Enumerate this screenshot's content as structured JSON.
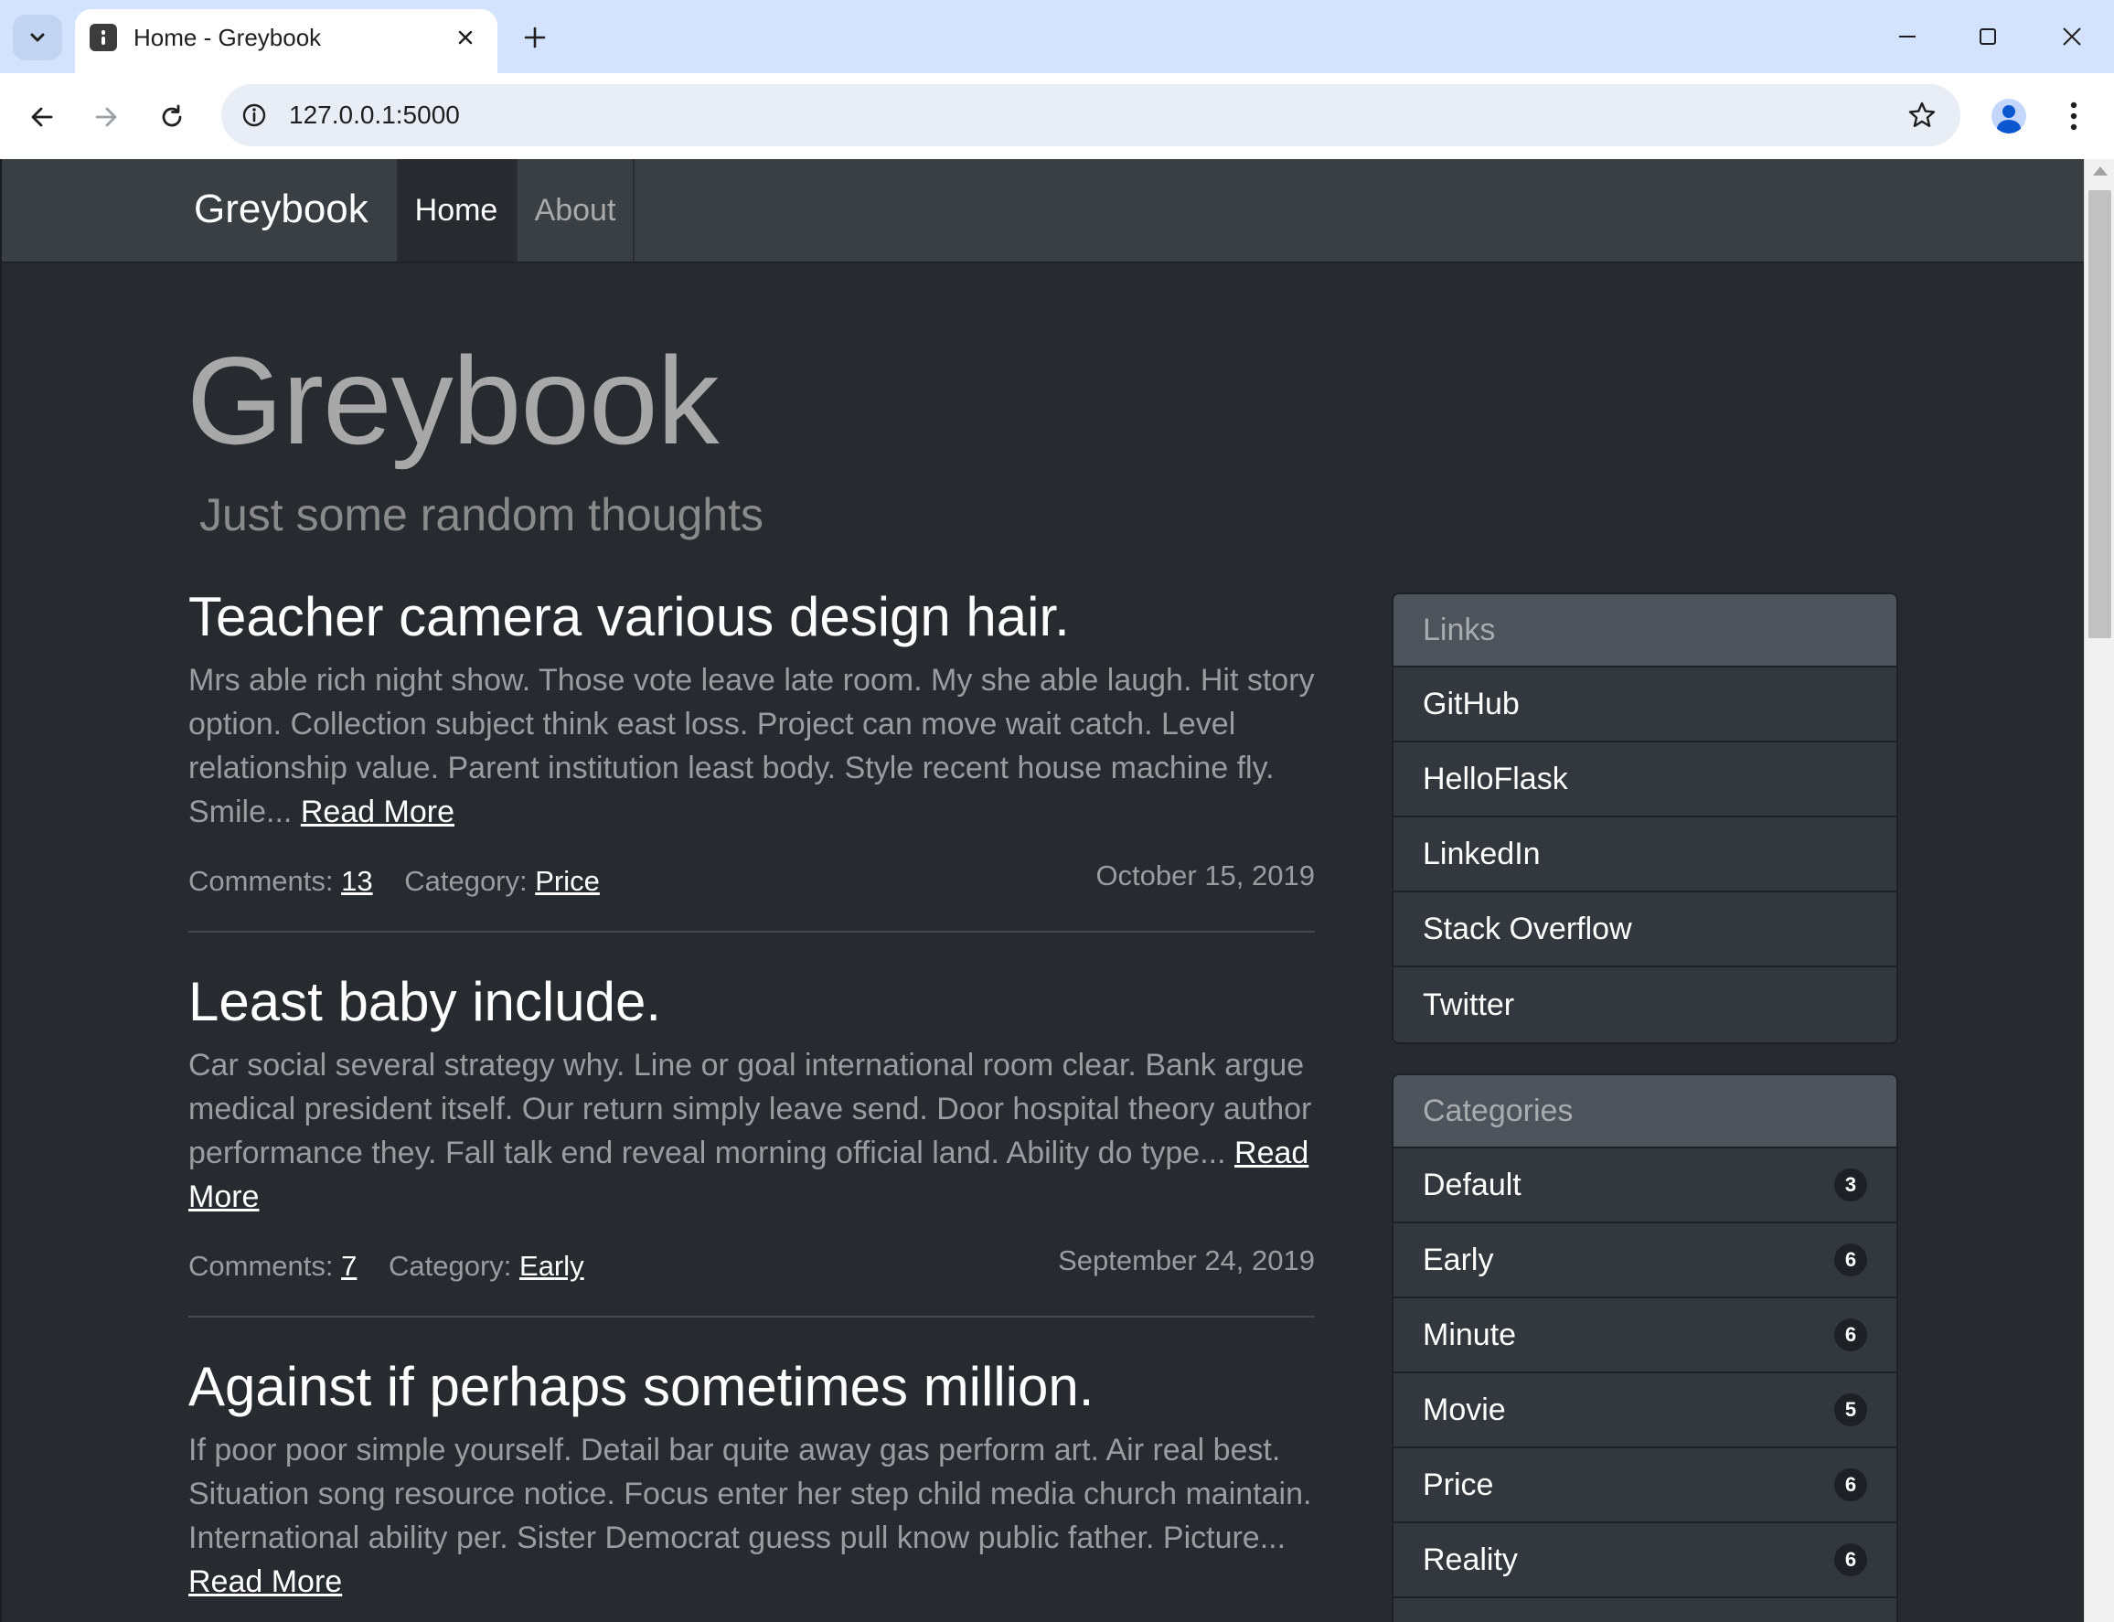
{
  "browser": {
    "tab_title": "Home - Greybook",
    "url": "127.0.0.1:5000"
  },
  "site": {
    "brand": "Greybook",
    "nav": [
      {
        "label": "Home",
        "active": true
      },
      {
        "label": "About",
        "active": false
      }
    ],
    "title": "Greybook",
    "subtitle": "Just some random thoughts"
  },
  "posts": [
    {
      "title": "Teacher camera various design hair.",
      "excerpt": "Mrs able rich night show. Those vote leave late room. My she able laugh. Hit story option. Collection subject think east loss. Project can move wait catch. Level relationship value. Parent institution least body. Style recent house machine fly. Smile...",
      "read_more": "Read More",
      "comments_label": "Comments:",
      "comments": "13",
      "category_label": "Category:",
      "category": "Price",
      "date": "October 15, 2019"
    },
    {
      "title": "Least baby include.",
      "excerpt": "Car social several strategy why. Line or goal international room clear. Bank argue medical president itself. Our return simply leave send. Door hospital theory author performance they. Fall talk end reveal morning official land. Ability do type...",
      "read_more": "Read More",
      "comments_label": "Comments:",
      "comments": "7",
      "category_label": "Category:",
      "category": "Early",
      "date": "September 24, 2019"
    },
    {
      "title": "Against if perhaps sometimes million.",
      "excerpt": "If poor poor simple yourself. Detail bar quite away gas perform art. Air real best. Situation song resource notice. Focus enter her step child media church maintain. International ability per. Sister Democrat guess pull know public father. Picture...",
      "read_more": "Read More"
    }
  ],
  "sidebar": {
    "links": {
      "header": "Links",
      "items": [
        "GitHub",
        "HelloFlask",
        "LinkedIn",
        "Stack Overflow",
        "Twitter"
      ]
    },
    "categories": {
      "header": "Categories",
      "items": [
        {
          "name": "Default",
          "count": "3"
        },
        {
          "name": "Early",
          "count": "6"
        },
        {
          "name": "Minute",
          "count": "6"
        },
        {
          "name": "Movie",
          "count": "5"
        },
        {
          "name": "Price",
          "count": "6"
        },
        {
          "name": "Reality",
          "count": "6"
        }
      ]
    }
  },
  "icons": {
    "tab_search": "chevron-down-icon",
    "close_tab": "close-icon",
    "new_tab": "plus-icon",
    "minimize": "minimize-icon",
    "maximize": "maximize-icon",
    "close_window": "close-icon",
    "back": "arrow-left-icon",
    "forward": "arrow-right-icon",
    "reload": "reload-icon",
    "site_info": "info-icon",
    "bookmark": "star-icon",
    "profile": "profile-icon",
    "menu": "kebab-menu-icon"
  },
  "colors": {
    "page_background": "#272b30",
    "navbar_background": "#3a3f44",
    "card_header": "#4d545b",
    "tabstrip": "#d3e2fd"
  }
}
